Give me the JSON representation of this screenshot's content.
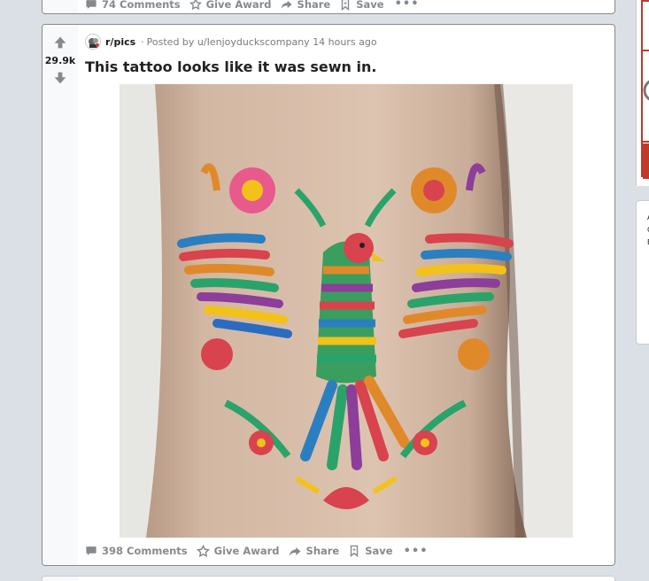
{
  "prev_post": {
    "actions": {
      "comments": "74 Comments",
      "award": "Give Award",
      "share": "Share",
      "save": "Save",
      "more": "•••"
    }
  },
  "post": {
    "score": "29.9k",
    "subreddit": "r/pics",
    "posted_by_prefix": "Posted by",
    "author": "u/Ienjoyduckscompany",
    "time": "14 hours ago",
    "title": "This tattoo looks like it was sewn in.",
    "actions": {
      "comments": "398 Comments",
      "award": "Give Award",
      "share": "Share",
      "save": "Save",
      "more": "•••"
    }
  },
  "sidebar": {
    "snippet_letters": [
      "A",
      "C",
      "E"
    ]
  },
  "colors": {
    "page_bg": "#dae0e6",
    "card_border": "#898989",
    "vote_col_bg": "#f8f9fa",
    "action_text": "#878a8c",
    "upvote_color": "#878a8c"
  },
  "icons": {
    "upvote": "arrow-up-icon",
    "downvote": "arrow-down-icon",
    "comments": "comment-bubble-icon",
    "award": "award-icon",
    "share": "share-arrow-icon",
    "save": "bookmark-icon",
    "more": "ellipsis-icon"
  }
}
